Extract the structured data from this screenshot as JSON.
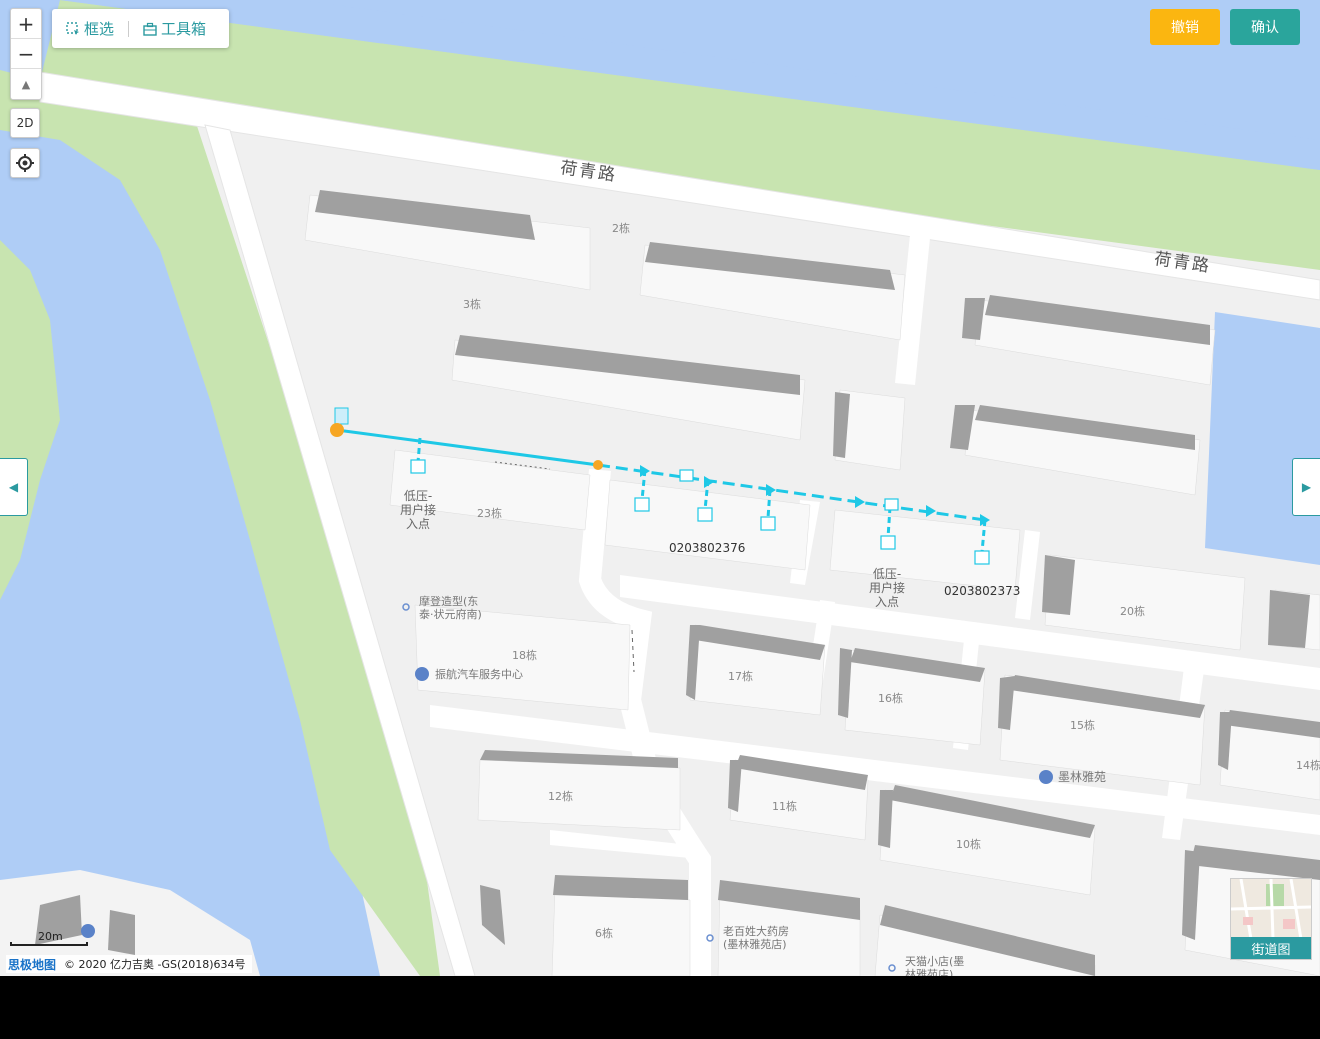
{
  "toolbar": {
    "zoom_in": "+",
    "zoom_out": "−",
    "compass": "▲",
    "view_mode": "2D",
    "locate_icon": "locate-icon",
    "box_select_label": "框选",
    "toolbox_label": "工具箱"
  },
  "actions": {
    "cancel_label": "撤销",
    "confirm_label": "确认",
    "cancel_color": "#fbb610",
    "confirm_color": "#2aa59c"
  },
  "map": {
    "roads": [
      "荷青路",
      "荷青路"
    ],
    "buildings": [
      "2栋",
      "3栋",
      "23栋",
      "18栋",
      "17栋",
      "16栋",
      "15栋",
      "14栋",
      "20栋",
      "12栋",
      "11栋",
      "10栋",
      "6栋"
    ],
    "nodes": [
      {
        "label": "低压-\n用户接\n入点"
      },
      {
        "label": "0203802376"
      },
      {
        "label": "低压-\n用户接\n入点"
      },
      {
        "label": "0203802373"
      }
    ],
    "pois": [
      {
        "name": "摩登造型(东\n泰·状元府南)"
      },
      {
        "name": "振航汽车服务中心"
      },
      {
        "name": "墨林雅苑"
      },
      {
        "name": "老百姓大药房\n(墨林雅苑店)"
      },
      {
        "name": "天猫小店(墨\n林雅苑店)"
      }
    ],
    "line_color": "#1ec8e6",
    "point_color": "#f6a623"
  },
  "minimap": {
    "label": "街道图"
  },
  "scale": {
    "label": "20m"
  },
  "attribution": {
    "brand": "思极地图",
    "copyright": "© 2020 亿力吉奥 -GS(2018)634号"
  },
  "nav": {
    "left_icon": "◀",
    "right_icon": "▶"
  }
}
